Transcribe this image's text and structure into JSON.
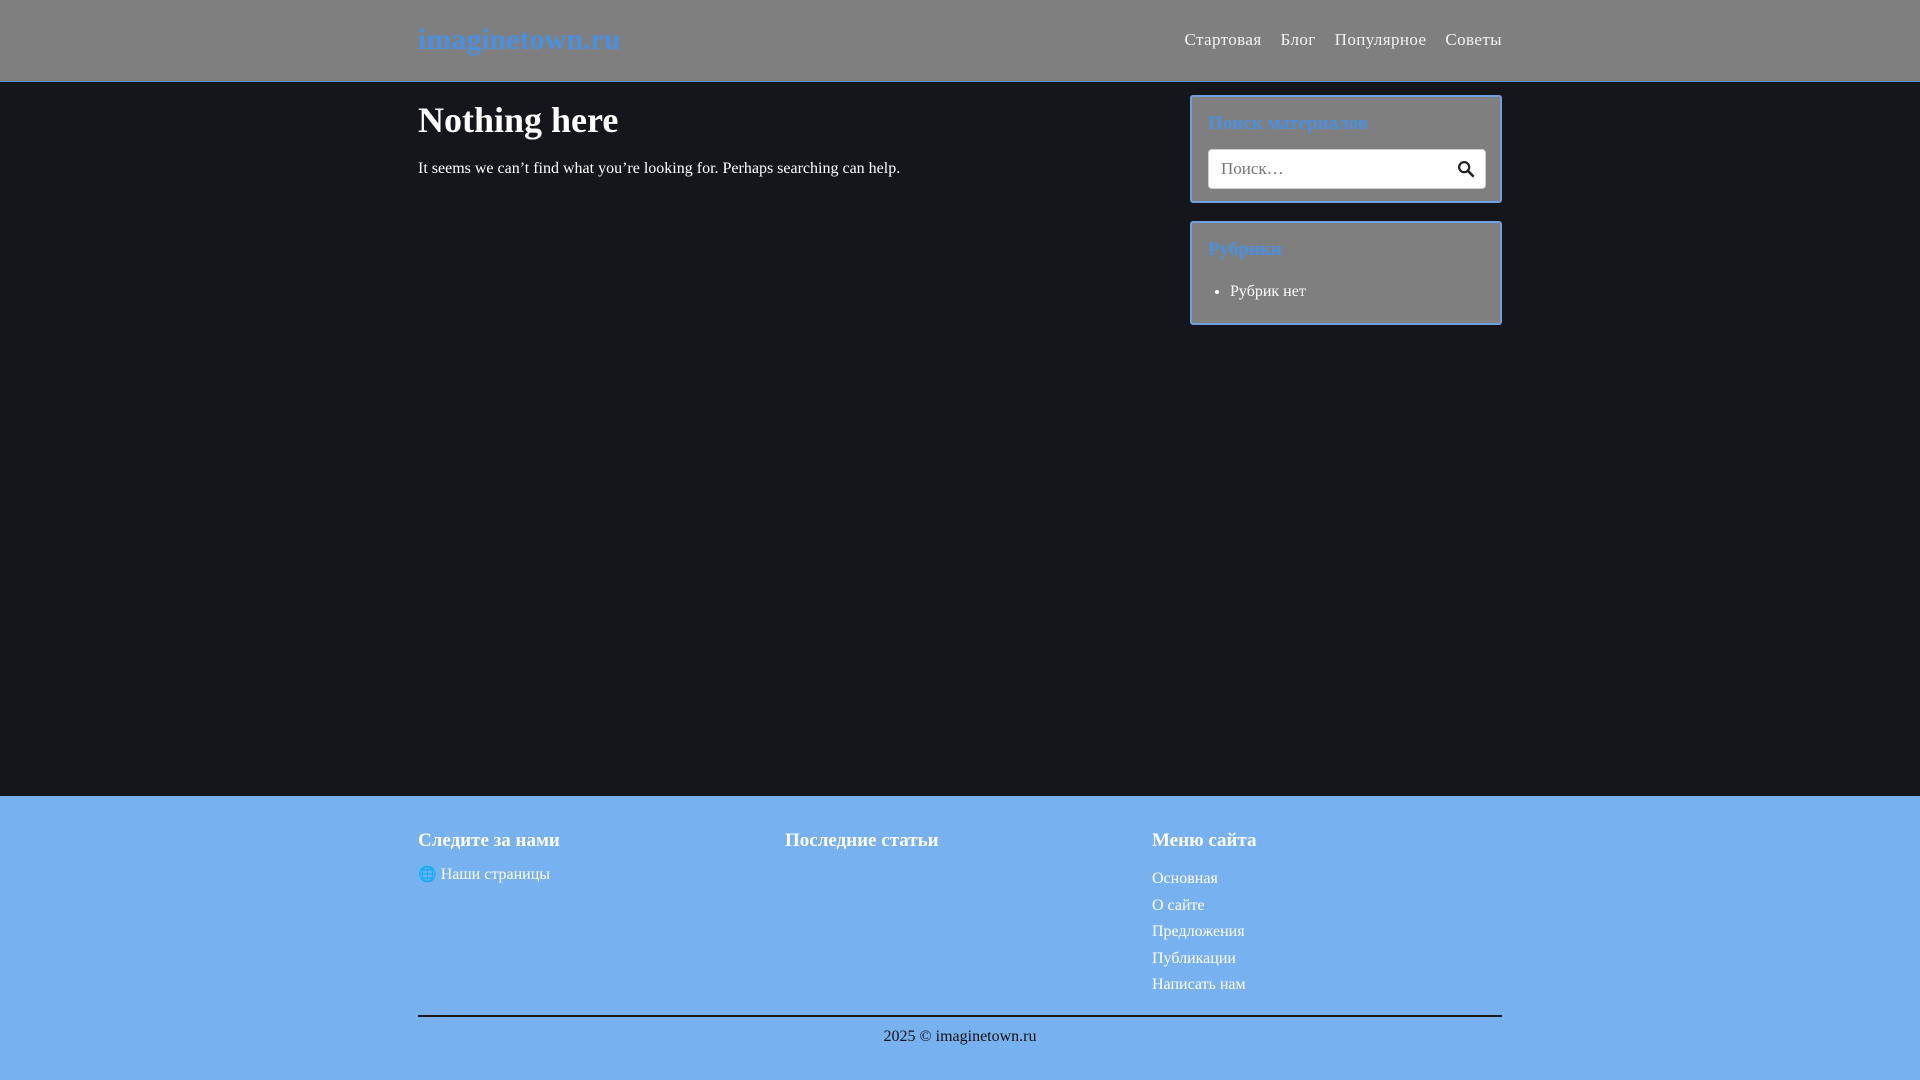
{
  "header": {
    "logo": "imaginetown.ru",
    "nav": [
      "Стартовая",
      "Блог",
      "Популярное",
      "Советы"
    ]
  },
  "main": {
    "title": "Nothing here",
    "text": "It seems we can’t find what you’re looking for. Perhaps searching can help."
  },
  "sidebar": {
    "search_widget": {
      "title": "Поиск материалов",
      "placeholder": "Поиск…",
      "button_icon": "search-icon"
    },
    "categories_widget": {
      "title": "Рубрики",
      "items": [
        "Рубрик нет"
      ]
    }
  },
  "footer": {
    "follow": {
      "title": "Следите за нами",
      "link_icon": "globe-icon",
      "link_label": "Наши страницы"
    },
    "recent": {
      "title": "Последние статьи"
    },
    "menu": {
      "title": "Меню сайта",
      "items": [
        "Основная",
        "О сайте",
        "Предложения",
        "Публикации",
        "Написать нам"
      ]
    },
    "copyright": "2025 © imaginetown.ru"
  },
  "colors": {
    "header_bg": "#7f7f7f",
    "page_bg": "#15161b",
    "accent": "#4a90e2",
    "footer_bg": "#78b1f0"
  }
}
